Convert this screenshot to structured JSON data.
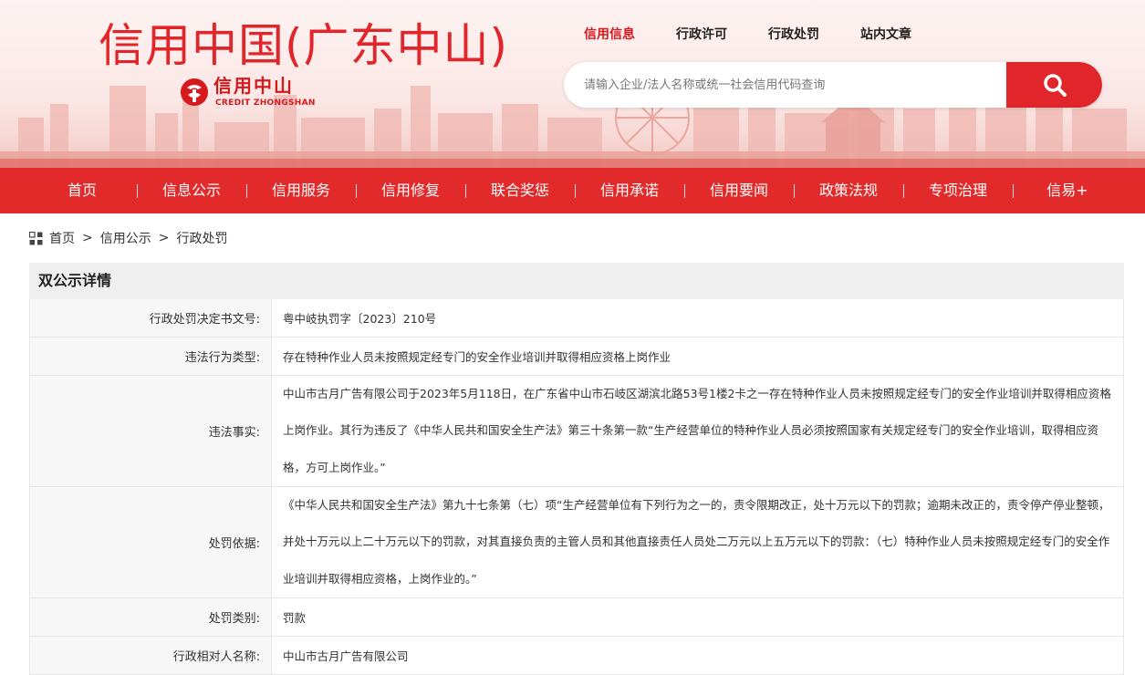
{
  "header": {
    "site_title": "信用中国(广东中山)",
    "logo_name": "信用中山",
    "logo_sub": "CREDIT ZHONGSHAN",
    "top_links": [
      "信用信息",
      "行政许可",
      "行政处罚",
      "站内文章"
    ],
    "active_link": "信用信息",
    "search_placeholder": "请输入企业/法人名称或统一社会信用代码查询",
    "search_icon": "search-icon",
    "accent_color": "#e0262a"
  },
  "nav": {
    "items": [
      "首页",
      "信息公示",
      "信用服务",
      "信用修复",
      "联合奖惩",
      "信用承诺",
      "信用要闻",
      "政策法规",
      "专项治理",
      "信易+"
    ]
  },
  "breadcrumb": {
    "icon": "grid-icon",
    "items": [
      "首页",
      "信用公示",
      "行政处罚"
    ],
    "separator": ">"
  },
  "detail": {
    "title": "双公示详情",
    "rows": [
      {
        "label": "行政处罚决定书文号:",
        "value": "粤中岐执罚字〔2023〕210号"
      },
      {
        "label": "违法行为类型:",
        "value": "存在特种作业人员未按照规定经专门的安全作业培训并取得相应资格上岗作业"
      },
      {
        "label": "违法事实:",
        "value": "中山市古月广告有限公司于2023年5月118日，在广东省中山市石岐区湖滨北路53号1楼2卡之一存在特种作业人员未按照规定经专门的安全作业培训并取得相应资格上岗作业。其行为违反了《中华人民共和国安全生产法》第三十条第一款“生产经营单位的特种作业人员必须按照国家有关规定经专门的安全作业培训，取得相应资格，方可上岗作业。”"
      },
      {
        "label": "处罚依据:",
        "value": "《中华人民共和国安全生产法》第九十七条第（七）项“生产经营单位有下列行为之一的，责令限期改正，处十万元以下的罚款；逾期未改正的，责令停产停业整顿，并处十万元以上二十万元以下的罚款，对其直接负责的主管人员和其他直接责任人员处二万元以上五万元以下的罚款：（七）特种作业人员未按照规定经专门的安全作业培训并取得相应资格，上岗作业的。”"
      },
      {
        "label": "处罚类别:",
        "value": "罚款"
      },
      {
        "label": "行政相对人名称:",
        "value": "中山市古月广告有限公司"
      }
    ]
  }
}
